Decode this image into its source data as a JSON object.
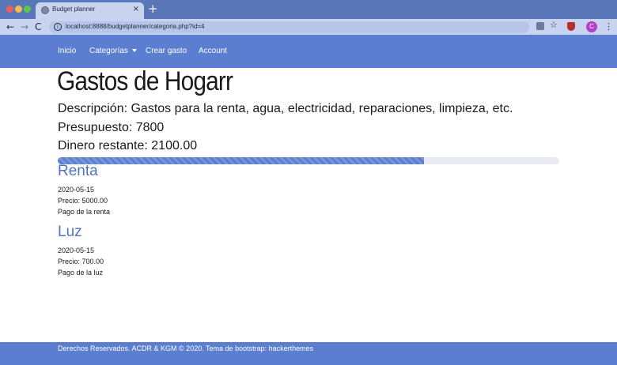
{
  "browser": {
    "tab_title": "Budget planner",
    "tab_close": "×",
    "new_tab": "+",
    "back": "←",
    "forward": "→",
    "reload": "C",
    "info": "i",
    "url": "localhost:8888/budgetplanner/categoria.php?id=4",
    "star": "☆",
    "avatar_letter": "C",
    "menu": "⋮"
  },
  "navbar": {
    "items": [
      {
        "label": "Inicio"
      },
      {
        "label": "Categorías"
      },
      {
        "label": "Crear gasto"
      },
      {
        "label": "Account"
      }
    ]
  },
  "category": {
    "title": "Gastos de Hogarr",
    "description": "Descripción: Gastos para la renta, agua, electricidad, reparaciones, limpieza, etc.",
    "budget": "Presupuesto: 7800",
    "remaining": "Dinero restante: 2100.00",
    "progress_percent": 73.1
  },
  "expenses": [
    {
      "title": "Renta",
      "date": "2020-05-15",
      "price": "Precio: 5000.00",
      "note": "Pago de la renta"
    },
    {
      "title": "Luz",
      "date": "2020-05-15",
      "price": "Precio: 700.00",
      "note": "Pago de la luz"
    }
  ],
  "footer": {
    "text": "Derechos Reservados. ACDR & KGM © 2020. Tema de bootstrap: hackerthemes"
  },
  "colors": {
    "accent": "#5b7ed0",
    "heading_link": "#4f74c4",
    "chrome": "#5977b8"
  }
}
